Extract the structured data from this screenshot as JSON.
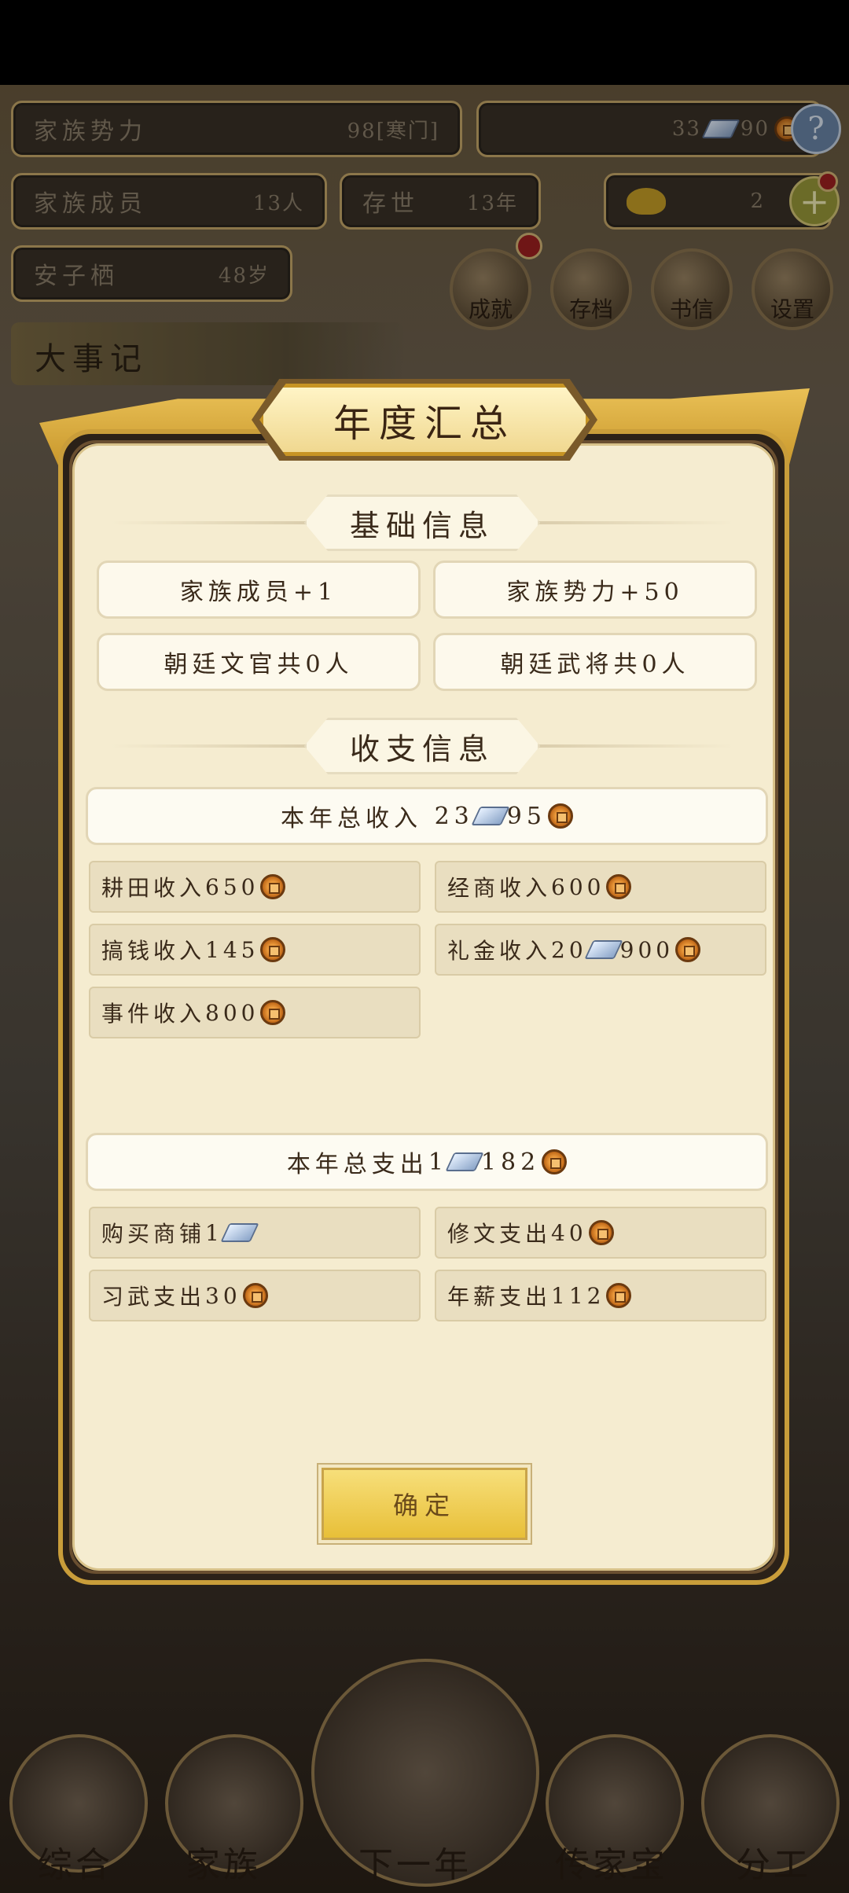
{
  "background": {
    "family_power": {
      "label": "家族势力",
      "value": "98[寒门]"
    },
    "money": {
      "silver": "33",
      "copper": "90",
      "help_icon": "?"
    },
    "family_members": {
      "label": "家族成员",
      "value": "13人"
    },
    "existence": {
      "label": "存世",
      "value": "13年"
    },
    "gold": {
      "value": "2",
      "add_icon": "+"
    },
    "person": {
      "label": "安子栖",
      "value": "48岁"
    },
    "round_buttons": [
      "成就",
      "存档",
      "书信",
      "设置"
    ],
    "events_title": "大事记",
    "nav": [
      "综合",
      "家族",
      "下一年",
      "传家宝",
      "分工"
    ]
  },
  "dialog": {
    "title": "年度汇总",
    "basic_section": "基础信息",
    "basic_info": [
      "家族成员+1",
      "家族势力+50",
      "朝廷文官共0人",
      "朝廷武将共0人"
    ],
    "finance_section": "收支信息",
    "income_total": {
      "label": "本年总收入",
      "silver": "23",
      "copper": "95"
    },
    "income_items": [
      {
        "label": "耕田收入",
        "copper": "650"
      },
      {
        "label": "经商收入",
        "copper": "600"
      },
      {
        "label": "搞钱收入",
        "copper": "145"
      },
      {
        "label": "礼金收入",
        "silver": "20",
        "copper": "900"
      },
      {
        "label": "事件收入",
        "copper": "800"
      }
    ],
    "expense_total": {
      "label": "本年总支出",
      "silver": "1",
      "copper": "182"
    },
    "expense_items": [
      {
        "label": "购买商铺",
        "silver": "1"
      },
      {
        "label": "修文支出",
        "copper": "40"
      },
      {
        "label": "习武支出",
        "copper": "30"
      },
      {
        "label": "年薪支出",
        "copper": "112"
      }
    ],
    "confirm_label": "确定"
  },
  "colors": {
    "gold_frame": "#c99d3a",
    "parchment": "#f5ecd0",
    "item_bg": "#e9dec0",
    "button": "#e8bf38"
  }
}
